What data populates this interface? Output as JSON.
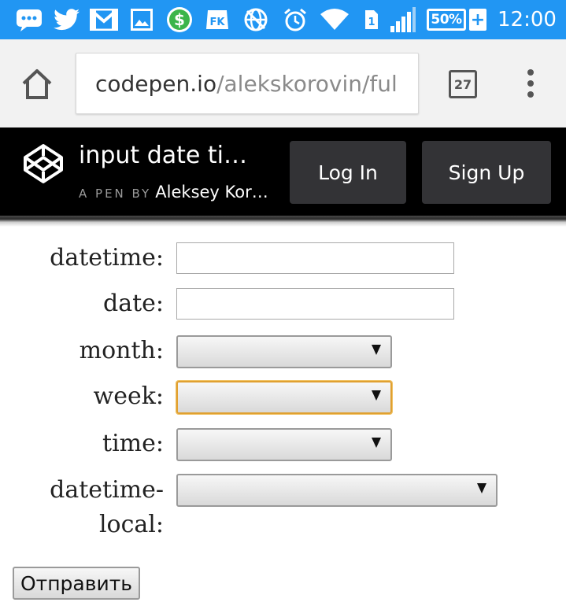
{
  "status_bar": {
    "battery": "50%",
    "battery_plus": "+",
    "time": "12:00",
    "icons": [
      "messaging-icon",
      "twitter-icon",
      "gmail-icon",
      "gallery-icon",
      "money-app-icon",
      "fk-icon",
      "vpn-icon",
      "alarm-icon",
      "wifi-icon",
      "sim-icon",
      "signal-icon",
      "battery-icon"
    ]
  },
  "browser": {
    "url_host": "codepen.io",
    "url_path": "/alekskorovin/ful",
    "tab_count": "27",
    "icons": [
      "home-icon",
      "tabs-icon",
      "overflow-menu-icon"
    ]
  },
  "codepen": {
    "pen_title": "input date ti…",
    "byline_prefix": "A PEN BY",
    "author": "Aleksey Kor…",
    "login_label": "Log In",
    "signup_label": "Sign Up",
    "logo_icon": "codepen-logo-icon"
  },
  "form": {
    "fields": [
      {
        "label": "datetime:",
        "type": "text",
        "value": ""
      },
      {
        "label": "date:",
        "type": "text",
        "value": ""
      },
      {
        "label": "month:",
        "type": "select",
        "value": ""
      },
      {
        "label": "week:",
        "type": "select",
        "value": "",
        "focused": true
      },
      {
        "label": "time:",
        "type": "select",
        "value": ""
      },
      {
        "label_line1": "datetime-",
        "label_line2": "local:",
        "type": "select",
        "value": ""
      }
    ],
    "submit_label": "Отправить"
  },
  "colors": {
    "status_bar": "#2196f3",
    "codepen_header": "#000000",
    "codepen_button": "#333336",
    "focus_ring": "#e0a030"
  }
}
